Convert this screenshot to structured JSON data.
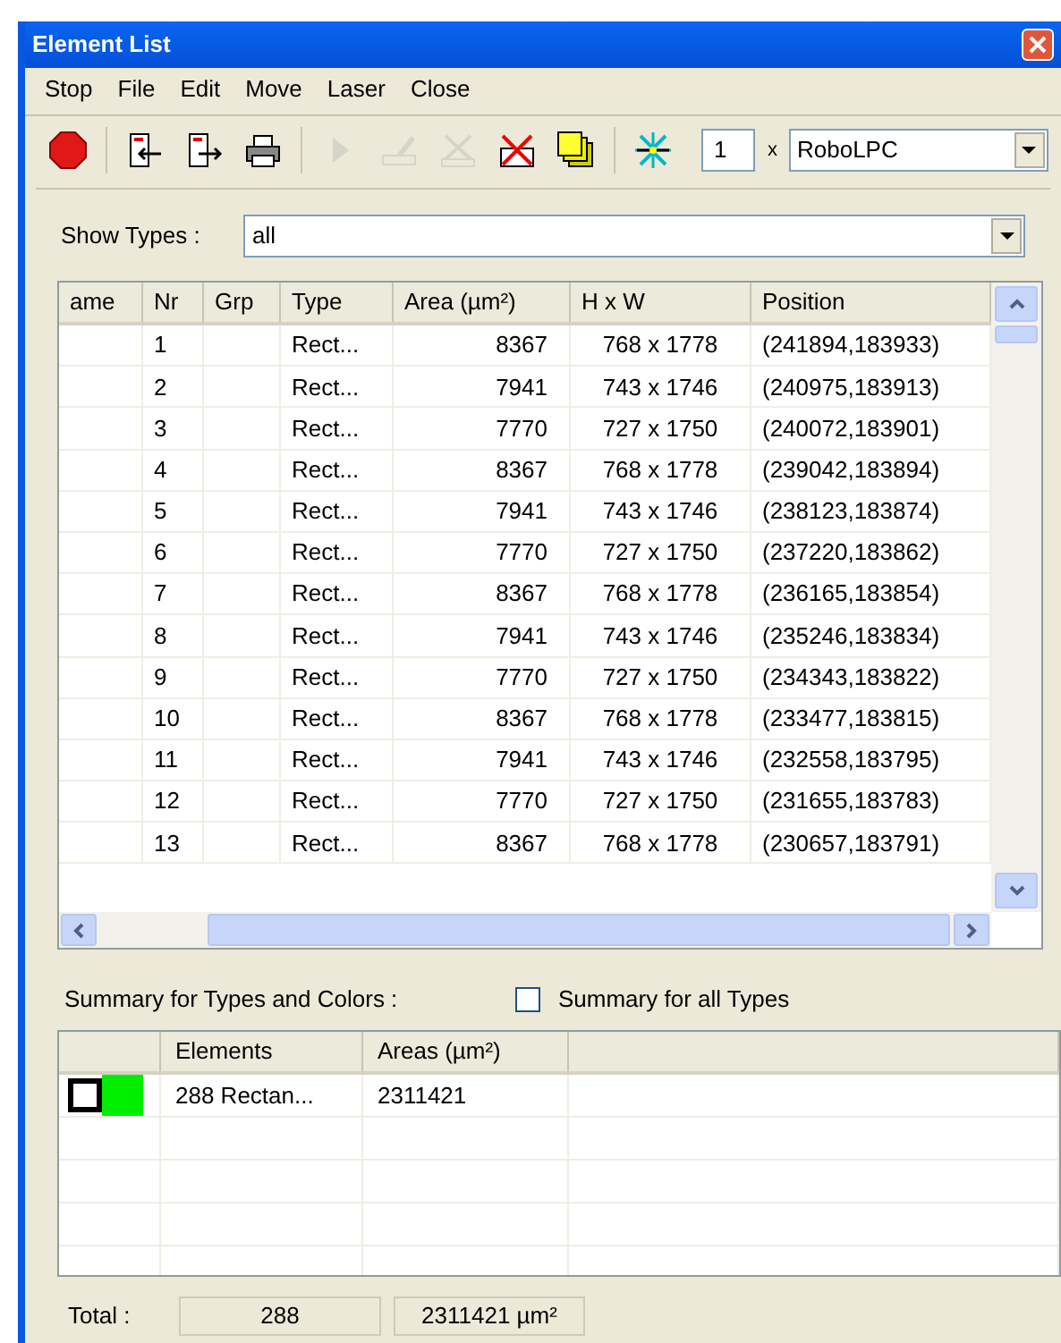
{
  "window": {
    "title": "Element List"
  },
  "menu": [
    "Stop",
    "File",
    "Edit",
    "Move",
    "Laser",
    "Close"
  ],
  "toolbar": {
    "buttons": [
      {
        "kind": "stop",
        "disabled": false
      },
      {
        "kind": "import",
        "disabled": false
      },
      {
        "kind": "export",
        "disabled": false
      },
      {
        "kind": "print",
        "disabled": false
      },
      {
        "kind": "play",
        "disabled": true
      },
      {
        "kind": "edit",
        "disabled": true
      },
      {
        "kind": "delete",
        "disabled": true
      },
      {
        "kind": "delete-all",
        "disabled": false
      },
      {
        "kind": "numbering",
        "disabled": false
      },
      {
        "kind": "center",
        "disabled": false
      }
    ],
    "count": "1",
    "times": "x",
    "device": "RoboLPC"
  },
  "show_types": {
    "label": "Show Types :",
    "value": "all"
  },
  "table": {
    "columns": [
      "ame",
      "Nr",
      "Grp",
      "Type",
      "Area (µm²)",
      "H x W",
      "Position"
    ],
    "rows": [
      [
        "",
        "1",
        "",
        "Rect...",
        "8367",
        "768 x 1778",
        "(241894,183933)"
      ],
      [
        "",
        "2",
        "",
        "Rect...",
        "7941",
        "743 x 1746",
        "(240975,183913)"
      ],
      [
        "",
        "3",
        "",
        "Rect...",
        "7770",
        "727 x 1750",
        "(240072,183901)"
      ],
      [
        "",
        "4",
        "",
        "Rect...",
        "8367",
        "768 x 1778",
        "(239042,183894)"
      ],
      [
        "",
        "5",
        "",
        "Rect...",
        "7941",
        "743 x 1746",
        "(238123,183874)"
      ],
      [
        "",
        "6",
        "",
        "Rect...",
        "7770",
        "727 x 1750",
        "(237220,183862)"
      ],
      [
        "",
        "7",
        "",
        "Rect...",
        "8367",
        "768 x 1778",
        "(236165,183854)"
      ],
      [
        "",
        "8",
        "",
        "Rect...",
        "7941",
        "743 x 1746",
        "(235246,183834)"
      ],
      [
        "",
        "9",
        "",
        "Rect...",
        "7770",
        "727 x 1750",
        "(234343,183822)"
      ],
      [
        "",
        "10",
        "",
        "Rect...",
        "8367",
        "768 x 1778",
        "(233477,183815)"
      ],
      [
        "",
        "11",
        "",
        "Rect...",
        "7941",
        "743 x 1746",
        "(232558,183795)"
      ],
      [
        "",
        "12",
        "",
        "Rect...",
        "7770",
        "727 x 1750",
        "(231655,183783)"
      ],
      [
        "",
        "13",
        "",
        "Rect...",
        "8367",
        "768 x 1778",
        "(230657,183791)"
      ]
    ]
  },
  "summary": {
    "label": "Summary for Types and Colors :",
    "all_types": {
      "label": "Summary for all Types",
      "checked": false
    },
    "columns": [
      "",
      "Elements",
      "Areas (µm²)",
      ""
    ],
    "rows": [
      {
        "checked": false,
        "color": "#00ee00",
        "elements": "288 Rectan...",
        "areas": "2311421"
      }
    ]
  },
  "total": {
    "label": "Total :",
    "count": "288",
    "area": "2311421 µm²"
  }
}
